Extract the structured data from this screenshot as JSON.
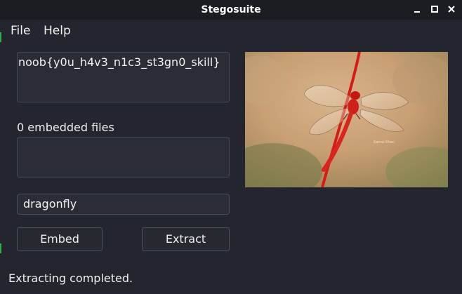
{
  "window": {
    "title": "Stegosuite",
    "controls": [
      "minimize",
      "maximize",
      "close"
    ]
  },
  "menu": {
    "items": [
      "File",
      "Help"
    ]
  },
  "message": {
    "text": "noob{y0u_h4v3_n1c3_st3gn0_skill}"
  },
  "files": {
    "label": "0 embedded files",
    "items": []
  },
  "password": {
    "value": "dragonfly"
  },
  "buttons": {
    "embed": "Embed",
    "extract": "Extract"
  },
  "status": {
    "text": "Extracting completed."
  },
  "image": {
    "subject": "red dragonfly on stem",
    "watermark": "Kamal Khan"
  },
  "colors": {
    "background": "#23262e",
    "titlebar": "#1b1d23",
    "field": "#2a2d36",
    "border": "#434654"
  }
}
